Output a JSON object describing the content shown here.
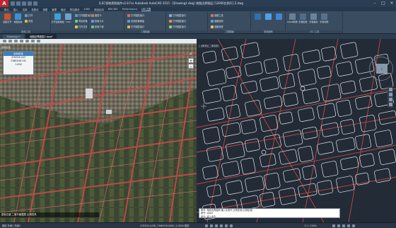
{
  "app": {
    "title": "[LSC领地规划插件v2.8 For Autodesk AutoCAD 2015 - [Drawing1.dwg] 地图边界图层 [12000比例尺] Z.dwg",
    "logo_letter": "A"
  },
  "menu_tabs": [
    "默认",
    "插入",
    "注释",
    "参数化",
    "视图",
    "管理",
    "输出",
    "附加模块",
    "A360",
    "精选应用",
    "BIM 360",
    "Performance",
    "LSC工具"
  ],
  "menu_active_index": 12,
  "ribbon": {
    "groups": [
      {
        "label": "影像工具",
        "big_buttons": [
          {
            "label": "图层打开",
            "color": "#c9542b"
          },
          {
            "label": "地图加载",
            "color": "#3f8fd6"
          }
        ],
        "small_buttons": [
          {
            "label": "打开",
            "color": "#57a0e0"
          },
          {
            "label": "关闭",
            "color": "#e0b83e"
          }
        ]
      },
      {
        "label": "",
        "big_buttons": [
          {
            "label": "打开谷歌地图",
            "color": "#3aa1d8"
          },
          {
            "label": "CAD",
            "color": "#6aa3d2"
          }
        ],
        "small_buttons": [
          {
            "label": "打开图层窗口",
            "color": "#4f9edc"
          },
          {
            "label": "导出影像",
            "color": "#6ccf82"
          },
          {
            "label": "打开文件",
            "color": "#e2c45c"
          }
        ]
      },
      {
        "label": "",
        "big_buttons": [],
        "small_buttons": [
          {
            "label": "图层卡",
            "color": "#c97b4d"
          },
          {
            "label": "影像卡片",
            "color": "#5aa1df"
          },
          {
            "label": "影像下载",
            "color": "#68c287"
          }
        ]
      },
      {
        "label": "工程图面",
        "big_buttons": [],
        "small_buttons": [
          {
            "label": "打开图层窗口",
            "color": "#dd6b5a"
          },
          {
            "label": "关闭影像覆盖",
            "color": "#5b9be0"
          },
          {
            "label": "打开图层窗口",
            "color": "#e1b949"
          }
        ]
      },
      {
        "label": "",
        "big_buttons": [],
        "small_buttons": [
          {
            "label": "打开图层窗口",
            "color": "#7ab3e8"
          },
          {
            "label": "打开图层窗口",
            "color": "#e1924f"
          },
          {
            "label": "打开图层窗口",
            "color": "#9bc46a"
          }
        ]
      },
      {
        "label": "工程图面",
        "big_buttons": [],
        "small_buttons": [
          {
            "label": "道路工具",
            "color": "#e36f55"
          },
          {
            "label": "道路结构",
            "color": "#58a6df"
          },
          {
            "label": "道路标签",
            "color": "#e8c25b"
          }
        ]
      },
      {
        "label": "影像面积",
        "big_buttons": [
          {
            "label": "",
            "color": "#2f6fb3"
          },
          {
            "label": "",
            "color": "#4da0e8"
          },
          {
            "label": "",
            "color": "#3d87d0"
          }
        ],
        "small_buttons": []
      },
      {
        "label": "LSC 工具",
        "big_buttons": [
          {
            "label": "OSGB转换",
            "color": "#6b7f94"
          },
          {
            "label": "影像配准",
            "color": "#4f6c89"
          },
          {
            "label": "影像裁剪",
            "color": "#6a839d"
          },
          {
            "label": "影像调整",
            "color": "#58728c"
          }
        ],
        "small_buttons": []
      }
    ]
  },
  "doc_tabs": [
    "Drawing1*",
    "地图边界图层Z.dwg*"
  ],
  "doc_active_index": 1,
  "left_pane": {
    "coord_label": "坐标信息",
    "info_box": {
      "header": "坐标信息",
      "rows": [
        "476326.443",
        "2368306.191",
        "1.000"
      ]
    },
    "status_text": "鼠标左键 二维平面图层 比例关系"
  },
  "cad_pane": {
    "viewport_label": "[-][俯视][二维线框]",
    "viewcube_label": "上",
    "cmd_lines": [
      "命令: 指定边界面积 输入比例尺 比例关系(计算区域)",
      "命令: zoom",
      "命令: 键入命令"
    ]
  },
  "status_bar": {
    "model_label": "模型  布局1  布局2",
    "coords": "476326.4436, 2368526.0000, 0.0000  模型",
    "scale": "1:1 / 100%"
  },
  "colors": {
    "satellite_base": "#4a4e3e",
    "cad_background": "#222b36",
    "road_red": "#c24848",
    "parcel_white": "#e6e6ee"
  }
}
